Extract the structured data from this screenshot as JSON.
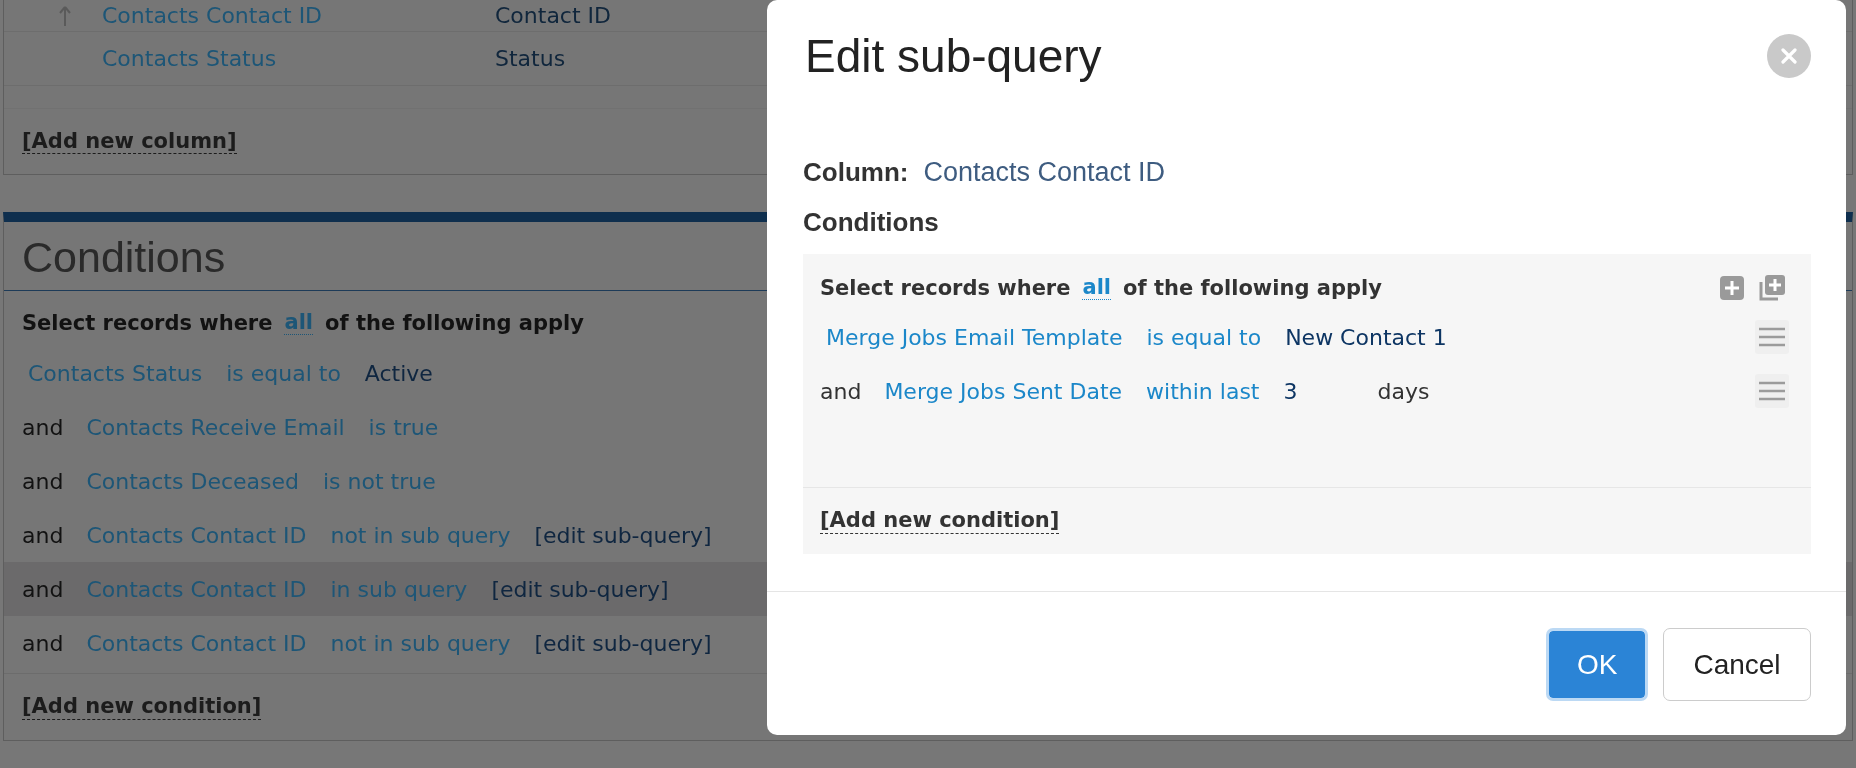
{
  "columns_panel": {
    "rows": [
      {
        "has_arrow": true,
        "column": "Contacts Contact ID",
        "label": "Contact ID"
      },
      {
        "has_arrow": false,
        "column": "Contacts Status",
        "label": "Status"
      }
    ],
    "add_link": "[Add new column]"
  },
  "conditions_panel": {
    "title": "Conditions",
    "match": {
      "prefix": "Select records where",
      "mode": "all",
      "suffix": "of the following apply"
    },
    "rows": [
      {
        "field": "Contacts Status",
        "operator": "is equal to",
        "value": "Active",
        "selected": false
      },
      {
        "conjunction": "and",
        "field": "Contacts Receive Email",
        "operator": "is true",
        "selected": false
      },
      {
        "conjunction": "and",
        "field": "Contacts Deceased",
        "operator": "is not true",
        "selected": false
      },
      {
        "conjunction": "and",
        "field": "Contacts Contact ID",
        "operator": "not in sub query",
        "edit_link": "[edit sub-query]",
        "selected": false
      },
      {
        "conjunction": "and",
        "field": "Contacts Contact ID",
        "operator": "in sub query",
        "edit_link": "[edit sub-query]",
        "selected": true
      },
      {
        "conjunction": "and",
        "field": "Contacts Contact ID",
        "operator": "not in sub query",
        "edit_link": "[edit sub-query]",
        "selected": false
      }
    ],
    "add_link": "[Add new condition]"
  },
  "modal": {
    "title": "Edit sub-query",
    "column_label": "Column:",
    "column_value": "Contacts Contact ID",
    "conditions_label": "Conditions",
    "match": {
      "prefix": "Select records where",
      "mode": "all",
      "suffix": "of the following apply"
    },
    "rows": [
      {
        "field": "Merge Jobs Email Template",
        "operator": "is equal to",
        "value": "New Contact 1"
      },
      {
        "conjunction": "and",
        "field": "Merge Jobs Sent Date",
        "operator": "within last",
        "value": "3",
        "unit": "days"
      }
    ],
    "add_link": "[Add new condition]",
    "buttons": [
      {
        "label": "OK",
        "kind": "primary",
        "focused": true
      },
      {
        "label": "Cancel",
        "kind": "secondary",
        "focused": false
      }
    ]
  }
}
